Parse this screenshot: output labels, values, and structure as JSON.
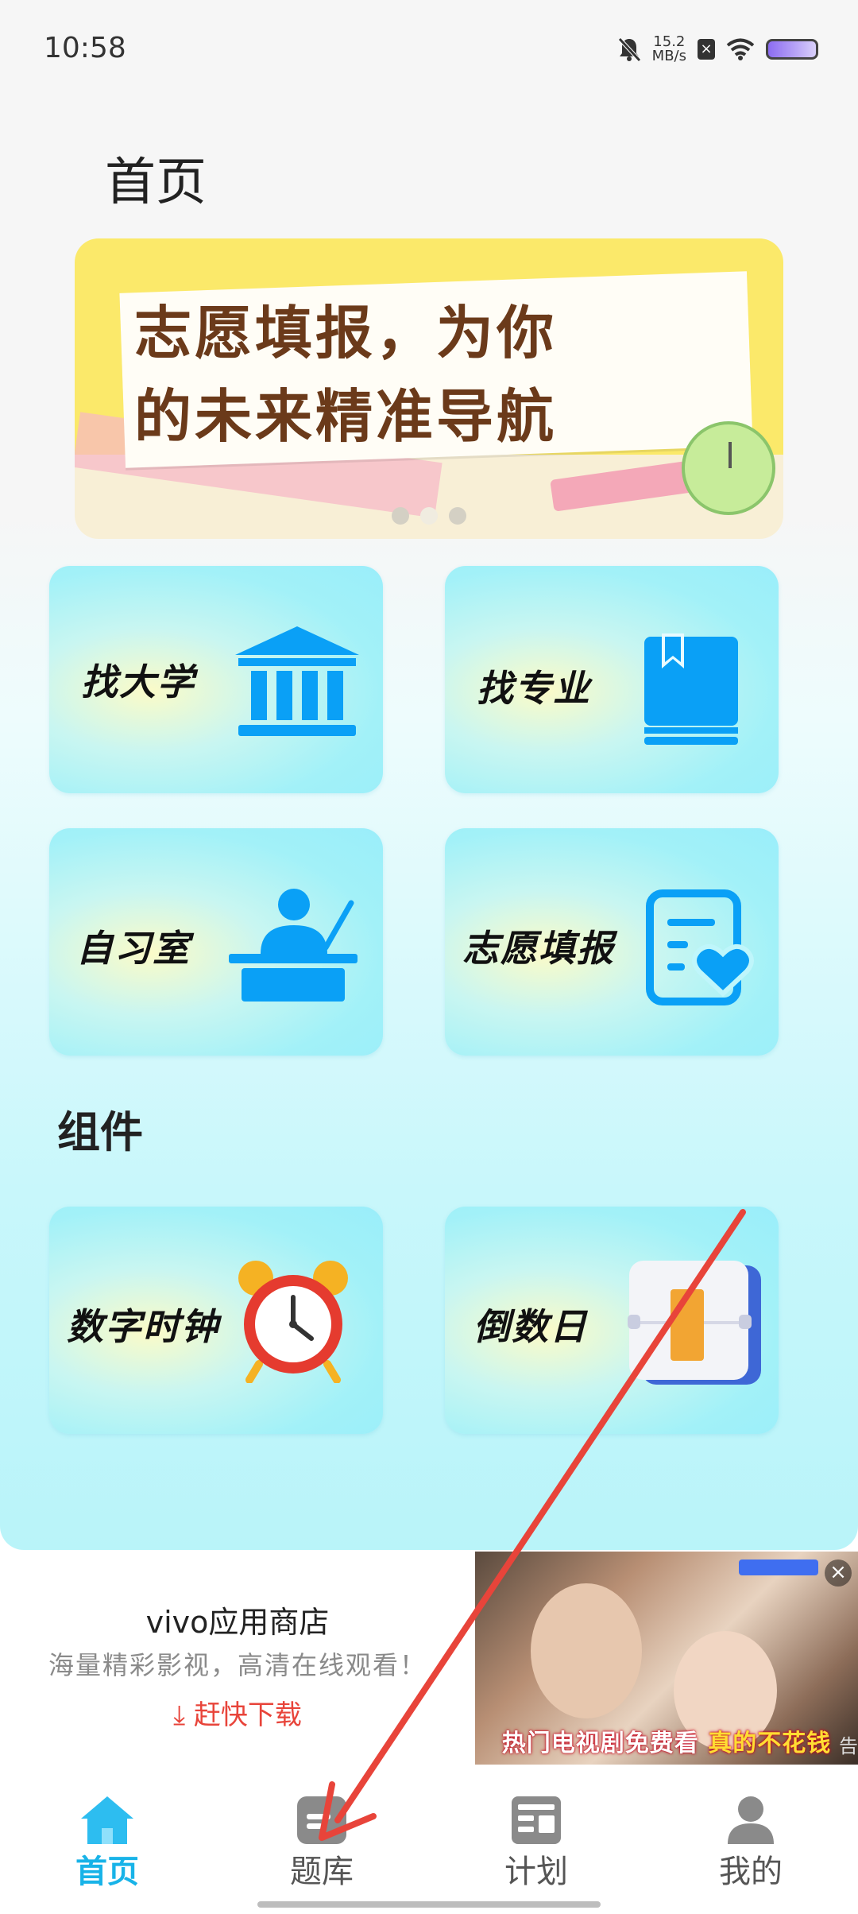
{
  "status_bar": {
    "time": "10:58",
    "speed_value": "15.2",
    "speed_unit": "MB/s",
    "icons": [
      "mute-bell-icon",
      "x-badge-icon",
      "wifi-icon",
      "battery-icon"
    ]
  },
  "header": {
    "title": "首页"
  },
  "banner": {
    "line1": "志愿填报，为你",
    "line2": "的未来精准导航",
    "indicator_total": 3,
    "indicator_active": 2
  },
  "features": [
    {
      "label": "找大学",
      "icon": "university-icon"
    },
    {
      "label": "找专业",
      "icon": "book-icon"
    },
    {
      "label": "自习室",
      "icon": "study-desk-icon"
    },
    {
      "label": "志愿填报",
      "icon": "form-heart-icon"
    }
  ],
  "widgets_section": {
    "title": "组件"
  },
  "widgets": [
    {
      "label": "数字时钟",
      "icon": "alarm-clock-icon"
    },
    {
      "label": "倒数日",
      "icon": "calendar-flip-icon"
    }
  ],
  "ad": {
    "title": "vivo应用商店",
    "subtitle": "海量精彩影视，高清在线观看！",
    "download": "赶快下载",
    "image_caption_part1": "热门电视剧免费看",
    "image_caption_part2": "真的不花钱",
    "ad_mark": "告"
  },
  "tabbar": {
    "items": [
      {
        "label": "首页",
        "icon": "home-icon",
        "active": true
      },
      {
        "label": "题库",
        "icon": "question-bank-icon",
        "active": false
      },
      {
        "label": "计划",
        "icon": "plan-icon",
        "active": false
      },
      {
        "label": "我的",
        "icon": "profile-icon",
        "active": false
      }
    ]
  },
  "colors": {
    "accent": "#18b3e8",
    "icon_blue": "#0aa0f6",
    "card_cyan": "#9aeefa",
    "download_red": "#e8443a"
  }
}
